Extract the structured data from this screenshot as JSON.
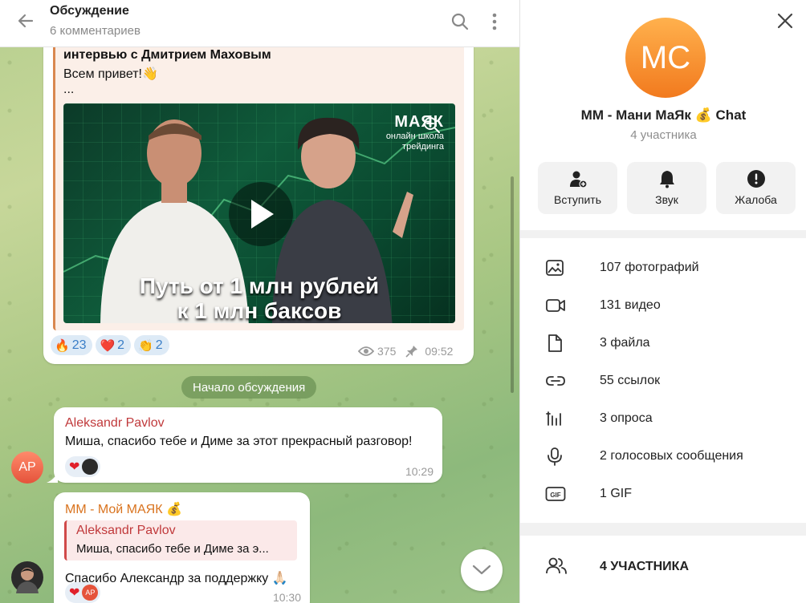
{
  "header": {
    "title": "Обсуждение",
    "subtitle": "6 комментариев"
  },
  "post": {
    "title": "интервью с Дмитрием Маховым",
    "greeting": "Всем привет!👋",
    "ellipsis": "...",
    "video": {
      "brand_name": "МАЯК",
      "brand_sub1": "онлайн школа",
      "brand_sub2": "трейдинга",
      "headline_line1": "Путь от 1 млн рублей",
      "headline_line2": "к 1 млн баксов"
    },
    "reactions": [
      {
        "emoji": "🔥",
        "count": "23"
      },
      {
        "emoji": "❤️",
        "count": "2"
      },
      {
        "emoji": "👏",
        "count": "2"
      }
    ],
    "views": "375",
    "time": "09:52"
  },
  "discussion_start": "Начало обсуждения",
  "messages": [
    {
      "author": "Aleksandr Pavlov",
      "author_color": "#c0393b",
      "text": "Миша, спасибо тебе и Диме за этот прекрасный разговор!",
      "time": "10:29",
      "avatar_initials": "AP"
    },
    {
      "author": "MM - Мой МАЯК 💰",
      "author_color": "#d9731e",
      "reply_author": "Aleksandr Pavlov",
      "reply_text": "Миша, спасибо тебе и Диме за э...",
      "text": "Спасибо Александр за поддержку 🙏🏻",
      "time": "10:30",
      "reaction_avatar": "AP"
    }
  ],
  "info": {
    "avatar_initials": "MC",
    "name": "MM - Мани МаЯк 💰 Chat",
    "subtitle": "4 участника",
    "actions": [
      {
        "label": "Вступить",
        "icon": "add-user-icon"
      },
      {
        "label": "Звук",
        "icon": "bell-icon"
      },
      {
        "label": "Жалоба",
        "icon": "warning-icon"
      }
    ],
    "media": [
      {
        "label": "107 фотографий",
        "icon": "photo-icon"
      },
      {
        "label": "131 видео",
        "icon": "video-icon"
      },
      {
        "label": "3 файла",
        "icon": "file-icon"
      },
      {
        "label": "55 ссылок",
        "icon": "link-icon"
      },
      {
        "label": "3 опроса",
        "icon": "poll-icon"
      },
      {
        "label": "2 голосовых сообщения",
        "icon": "microphone-icon"
      },
      {
        "label": "1 GIF",
        "icon": "gif-icon"
      }
    ],
    "members_label": "4 УЧАСТНИКА"
  },
  "colors": {
    "accent": "#3a7ec7",
    "avatar_gradient_top": "#ffb14d",
    "avatar_gradient_bottom": "#f27a1e"
  }
}
